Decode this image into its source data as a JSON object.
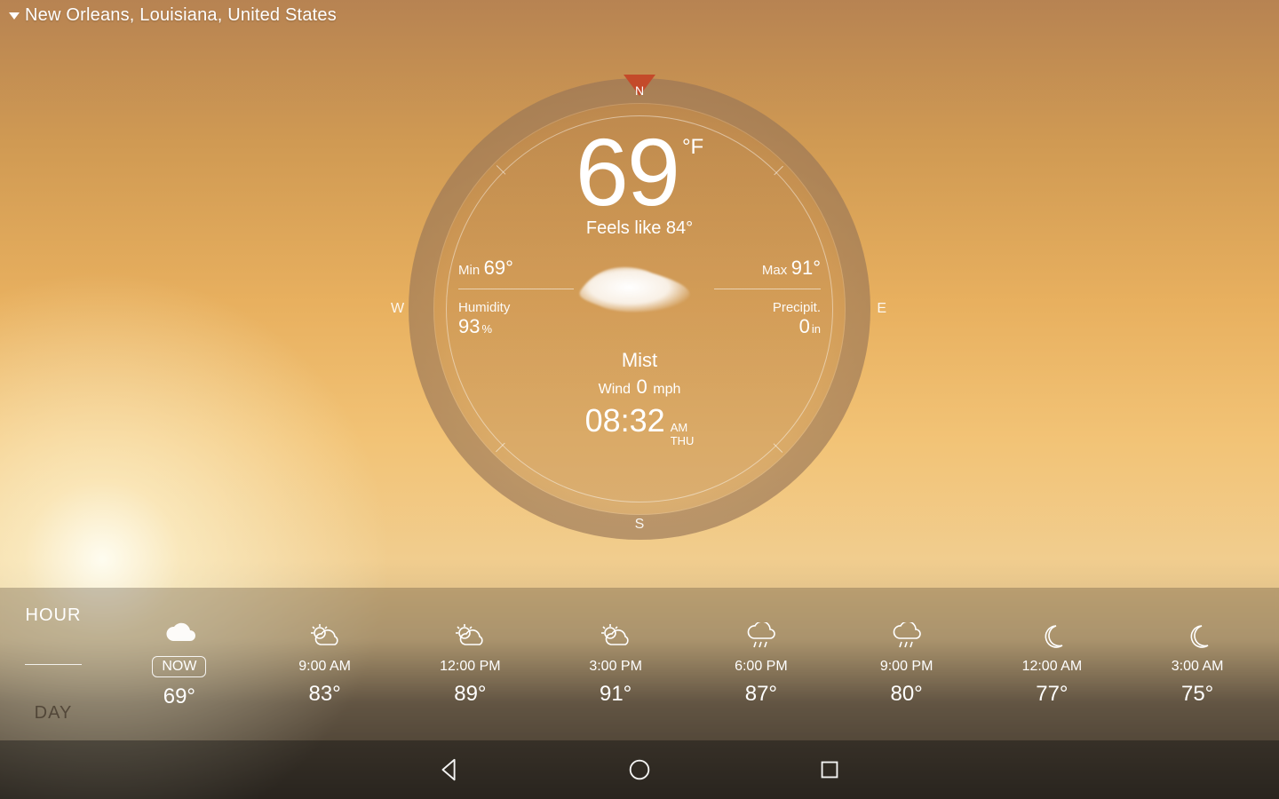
{
  "location": "New Orleans, Louisiana, United States",
  "compass": {
    "n": "N",
    "s": "S",
    "e": "E",
    "w": "W"
  },
  "current": {
    "temp": "69",
    "unit": "°F",
    "feels": "Feels like 84°",
    "min_label": "Min",
    "min_value": "69°",
    "max_label": "Max",
    "max_value": "91°",
    "humidity_label": "Humidity",
    "humidity_value": "93",
    "humidity_unit": "%",
    "precip_label": "Precipit.",
    "precip_value": "0",
    "precip_unit": "in",
    "condition": "Mist",
    "wind_label": "Wind",
    "wind_value": "0",
    "wind_unit": "mph",
    "time": "08:32",
    "ampm": "AM",
    "dow": "THU"
  },
  "strip": {
    "hour_label": "HOUR",
    "day_label": "DAY",
    "items": [
      {
        "when": "NOW",
        "temp": "69°",
        "icon": "cloud",
        "badge": true
      },
      {
        "when": "9:00 AM",
        "temp": "83°",
        "icon": "suncloud"
      },
      {
        "when": "12:00 PM",
        "temp": "89°",
        "icon": "suncloud"
      },
      {
        "when": "3:00 PM",
        "temp": "91°",
        "icon": "suncloud"
      },
      {
        "when": "6:00 PM",
        "temp": "87°",
        "icon": "rain"
      },
      {
        "when": "9:00 PM",
        "temp": "80°",
        "icon": "rain"
      },
      {
        "when": "12:00 AM",
        "temp": "77°",
        "icon": "moon"
      },
      {
        "when": "3:00 AM",
        "temp": "75°",
        "icon": "moon"
      }
    ]
  }
}
